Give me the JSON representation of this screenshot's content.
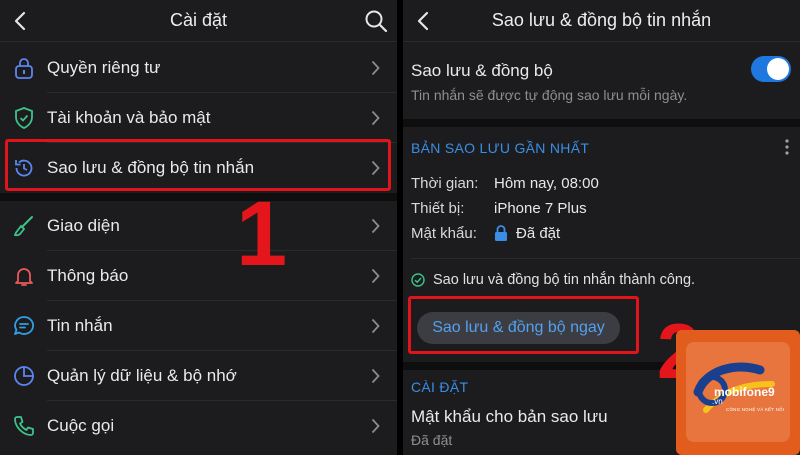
{
  "left": {
    "title": "Cài đặt",
    "items": [
      {
        "label": "Quyền riêng tư"
      },
      {
        "label": "Tài khoản và bảo mật"
      },
      {
        "label": "Sao lưu & đồng bộ tin nhắn"
      },
      {
        "label": "Giao diện"
      },
      {
        "label": "Thông báo"
      },
      {
        "label": "Tin nhắn"
      },
      {
        "label": "Quản lý dữ liệu & bộ nhớ"
      },
      {
        "label": "Cuộc gọi"
      }
    ],
    "step_marker": "1"
  },
  "right": {
    "title": "Sao lưu & đồng bộ tin nhắn",
    "sync": {
      "label": "Sao lưu & đồng bộ",
      "desc": "Tin nhắn sẽ được tự động sao lưu mỗi ngày.",
      "enabled": true
    },
    "latest": {
      "heading": "BẢN SAO LƯU GẦN NHẤT",
      "time_label": "Thời gian:",
      "time_value": "Hôm nay, 08:00",
      "device_label": "Thiết bị:",
      "device_value": "iPhone 7 Plus",
      "password_label": "Mật khẩu:",
      "password_value": "Đã đặt",
      "status": "Sao lưu và đồng bộ tin nhắn thành công.",
      "button": "Sao lưu & đồng bộ ngay"
    },
    "settings": {
      "heading": "CÀI ĐẶT",
      "backup_password_label": "Mật khẩu cho bản sao lưu",
      "backup_password_value": "Đã đặt"
    },
    "step_marker": "2"
  },
  "watermark": {
    "brand": "mobifone9",
    "domain": ".vn",
    "tagline": "CÔNG NGHỆ VÀ KẾT NỐI"
  },
  "colors": {
    "accent": "#1e78e0",
    "link": "#3a8ee6",
    "highlight": "#e0151b",
    "background": "#1c1c1e"
  }
}
